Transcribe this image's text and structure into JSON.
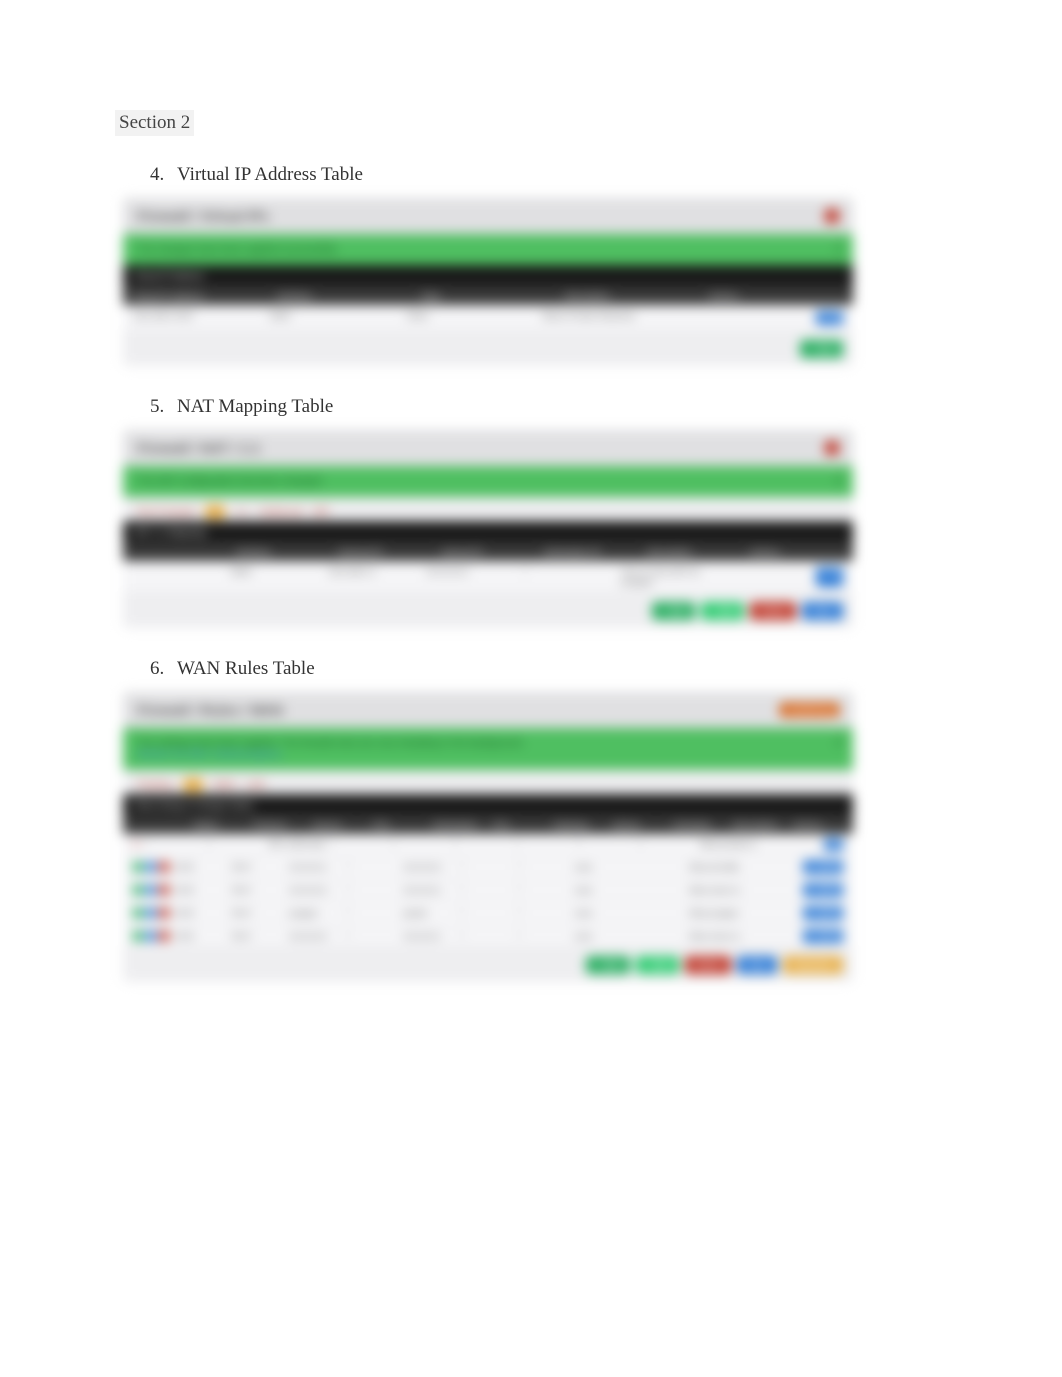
{
  "section_label": "Section 2",
  "list_start": 4,
  "items": [
    {
      "title": "Virtual IP Address Table",
      "panel": {
        "header": "Firewall / Virtual IPs",
        "header_badge": "red",
        "success": "The changes have been applied successfully.",
        "black_label": "Virtual IP Address",
        "columns": [
          "Virtual IP address",
          "Interface",
          "Type",
          "Description",
          "Actions"
        ],
        "rows": [
          {
            "cells": [
              "192.168.0.0/24",
              "WAN",
              "Other",
              "Block Private Networks",
              ""
            ],
            "action": "edit"
          }
        ],
        "footer": [
          "add"
        ]
      }
    },
    {
      "title": "NAT Mapping Table",
      "panel": {
        "header": "Firewall / NAT / 1:1",
        "header_badge": "red",
        "success": "The NAT configuration has been changed.",
        "tabs": [
          "Port Forward",
          "1:1",
          "Outbound",
          "NPt"
        ],
        "black_label": "NAT 1:1 Mappings",
        "columns": [
          "",
          "Interface",
          "External IP",
          "Internal IP",
          "Destination IP",
          "Description",
          "Actions"
        ],
        "rows": [
          {
            "cells": [
              "",
              "WAN",
              "192.168.0.1",
              "10.10.10.2",
              "*",
              "One to One NAT for pcapper",
              ""
            ],
            "action": "edit"
          }
        ],
        "footer": [
          "add",
          "add",
          "delete",
          "save"
        ]
      }
    },
    {
      "title": "WAN Rules Table",
      "panel": {
        "header": "Firewall / Rules / WAN",
        "header_badge": "orange",
        "header_badge_text": "monitoring",
        "success": "The settings have been applied. The firewall rules are now reloading in the background.",
        "success_link": "Monitor the filter reload progress.",
        "tabs": [
          "Floating",
          "WAN",
          "LAN"
        ],
        "black_label": "Rules (Drag to Change Order)",
        "columns": [
          "",
          "States",
          "Protocol",
          "Source",
          "Port",
          "Destination",
          "Port",
          "Gateway",
          "Queue",
          "Schedule",
          "Description",
          "Actions"
        ],
        "rows": [
          {
            "lead": "block",
            "cells": [
              "*",
              "*",
              "RFC 1918 networks",
              "*",
              "*",
              "*",
              "*",
              "*",
              "*",
              "Block private networks",
              ""
            ],
            "action": "gear"
          },
          {
            "lead": "pass",
            "cells": [
              "0/0 B",
              "IPv4 *",
              "10.10.10.1",
              "*",
              "10.10.10.2",
              "*",
              "*",
              "none",
              "",
              "Allow all traffic to 10.10.10.2",
              ""
            ],
            "action": "edit"
          },
          {
            "lead": "pass",
            "cells": [
              "0/0 B",
              "IPv4 *",
              "10.10.10.2",
              "*",
              "10.10.10.1",
              "*",
              "*",
              "none",
              "",
              "Allow return traffic",
              ""
            ],
            "action": "edit"
          },
          {
            "lead": "pass",
            "cells": [
              "0/0 B",
              "IPv4 *",
              "pcapper",
              "*",
              "packet",
              "*",
              "*",
              "none",
              "",
              "Allow pcapper to communicate packet",
              ""
            ],
            "action": "edit"
          },
          {
            "lead": "pass",
            "cells": [
              "0/0 B",
              "IPv4 *",
              "10.10.10.2",
              "*",
              "10.10.10.1",
              "*",
              "*",
              "none",
              "",
              "Allow return traffic",
              ""
            ],
            "action": "edit"
          }
        ],
        "footer": [
          "add",
          "add",
          "delete",
          "save",
          "separator"
        ]
      }
    }
  ]
}
